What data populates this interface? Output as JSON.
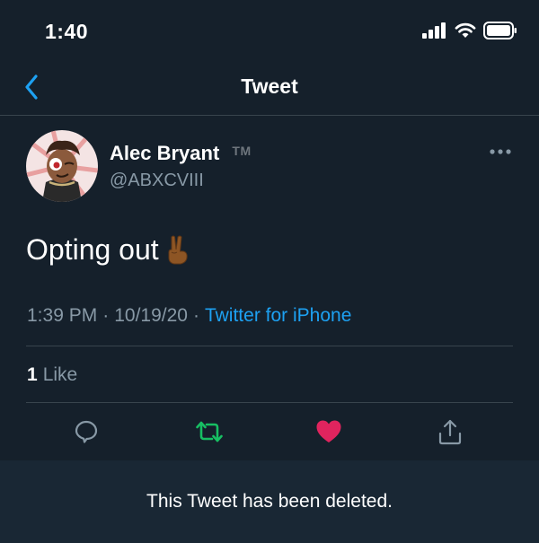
{
  "status_bar": {
    "time": "1:40",
    "icons": [
      "signal-icon",
      "wifi-icon",
      "battery-icon"
    ]
  },
  "nav": {
    "title": "Tweet",
    "back_icon": "chevron-left-icon"
  },
  "tweet": {
    "author": {
      "name": "Alec Bryant",
      "badge": "TM",
      "handle": "@ABXCVIII"
    },
    "text": "Opting out",
    "emoji": "victory-hand-icon",
    "time": "1:39 PM",
    "separator": "·",
    "date": "10/19/20",
    "source": "Twitter for iPhone",
    "likes": {
      "count": "1",
      "label": "Like"
    },
    "actions": [
      "reply-icon",
      "retweet-icon",
      "like-heart-icon",
      "share-icon"
    ]
  },
  "banner": {
    "text": "This Tweet has been deleted."
  },
  "colors": {
    "background": "#15202b",
    "banner_background": "#192734",
    "accent": "#1da1f2",
    "retweet": "#17bf63",
    "like": "#e0245e",
    "secondary_text": "#8899a6",
    "divider": "#38444d"
  }
}
